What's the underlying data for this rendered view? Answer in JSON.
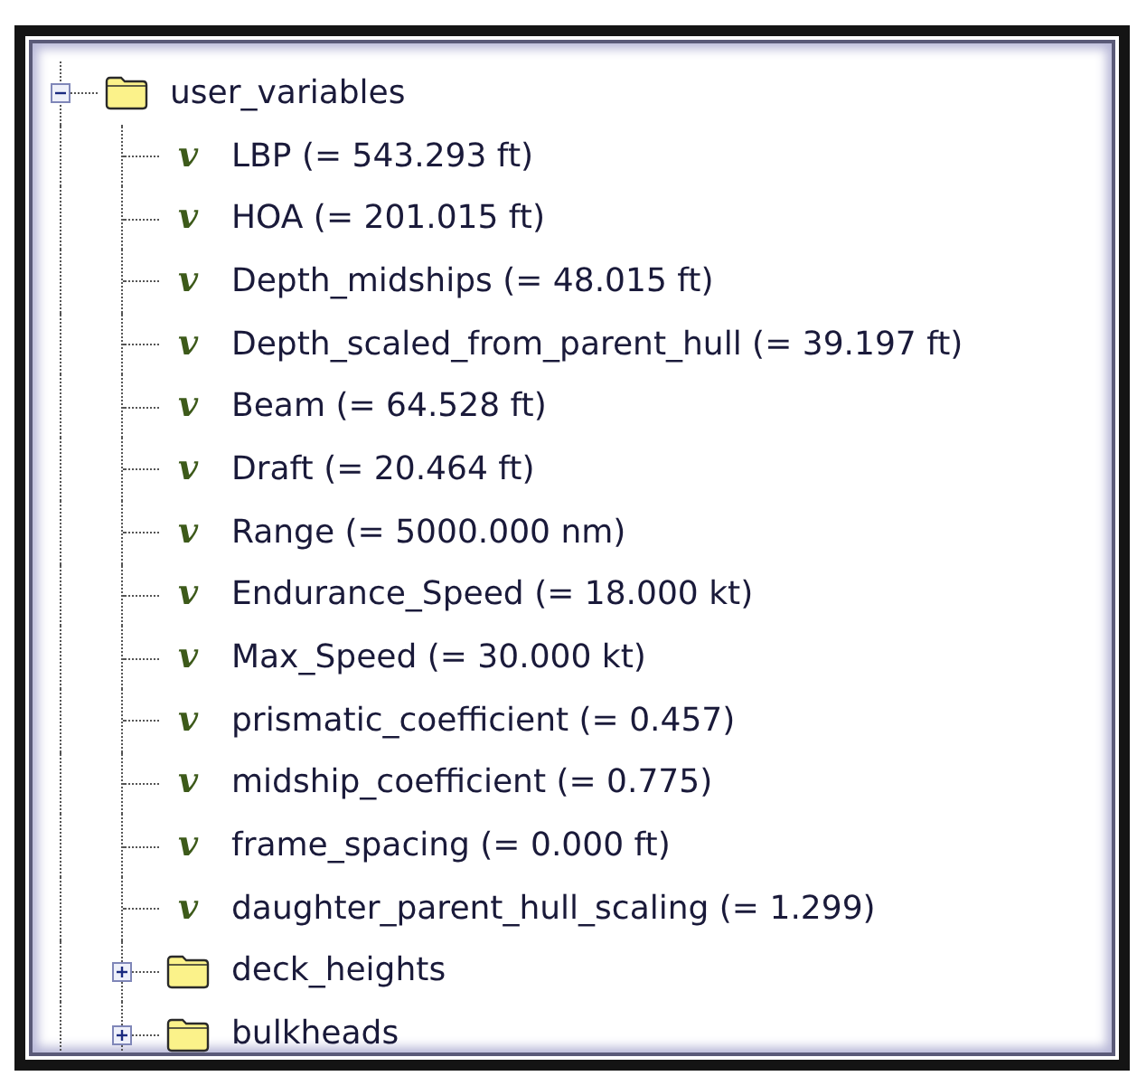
{
  "tree": [
    {
      "kind": "folder",
      "label": "user_variables",
      "expanded": true,
      "children": [
        {
          "kind": "variable",
          "glyph": "v",
          "label": "LBP (= 543.293 ft)"
        },
        {
          "kind": "variable",
          "glyph": "v",
          "label": "HOA (= 201.015 ft)"
        },
        {
          "kind": "variable",
          "glyph": "v",
          "label": "Depth_midships (= 48.015 ft)"
        },
        {
          "kind": "variable",
          "glyph": "v",
          "label": "Depth_scaled_from_parent_hull (= 39.197 ft)"
        },
        {
          "kind": "variable",
          "glyph": "v",
          "label": "Beam (= 64.528 ft)"
        },
        {
          "kind": "variable",
          "glyph": "v",
          "label": "Draft (= 20.464 ft)"
        },
        {
          "kind": "variable",
          "glyph": "v",
          "label": "Range (= 5000.000 nm)"
        },
        {
          "kind": "variable",
          "glyph": "v",
          "label": "Endurance_Speed (= 18.000 kt)"
        },
        {
          "kind": "variable",
          "glyph": "v",
          "label": "Max_Speed (= 30.000 kt)"
        },
        {
          "kind": "variable",
          "glyph": "v",
          "label": "prismatic_coefficient (= 0.457)"
        },
        {
          "kind": "variable",
          "glyph": "v",
          "label": "midship_coefficient (= 0.775)"
        },
        {
          "kind": "variable",
          "glyph": "v",
          "label": "frame_spacing (= 0.000 ft)"
        },
        {
          "kind": "variable",
          "glyph": "v",
          "label": "daughter_parent_hull_scaling (= 1.299)"
        },
        {
          "kind": "folder",
          "label": "deck_heights",
          "expanded": false
        },
        {
          "kind": "folder",
          "label": "bulkheads",
          "expanded": false
        }
      ]
    }
  ]
}
